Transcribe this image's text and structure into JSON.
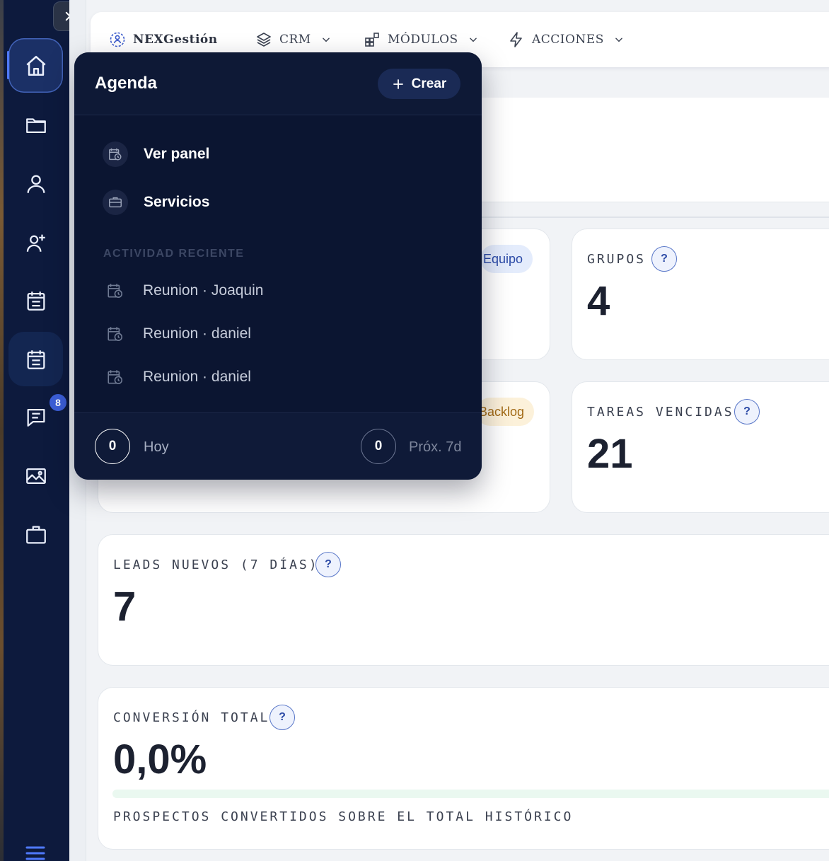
{
  "sidebar": {
    "toggle_icon": "chevron-right-icon",
    "items": [
      {
        "name": "home",
        "icon": "home-icon"
      },
      {
        "name": "folder",
        "icon": "folder-icon"
      },
      {
        "name": "user",
        "icon": "user-icon"
      },
      {
        "name": "add-user",
        "icon": "user-plus-icon"
      },
      {
        "name": "calendar",
        "icon": "calendar-icon"
      },
      {
        "name": "agenda",
        "icon": "calendar-icon"
      },
      {
        "name": "messages",
        "icon": "message-icon",
        "badge": "8"
      },
      {
        "name": "gallery",
        "icon": "image-icon"
      },
      {
        "name": "briefcase",
        "icon": "briefcase-icon"
      }
    ],
    "menu_icon": "hamburger-icon"
  },
  "topbar": {
    "brand": "NEXGestión",
    "menus": [
      {
        "label": "CRM",
        "icon": "layers-icon"
      },
      {
        "label": "MÓDULOS",
        "icon": "grid-plus-icon"
      },
      {
        "label": "ACCIONES",
        "icon": "bolt-icon"
      }
    ]
  },
  "cards": {
    "equipo_chip": "Equipo",
    "backlog_chip": "Backlog",
    "grupos": {
      "label": "GRUPOS",
      "value": "4"
    },
    "tareas_vencidas": {
      "label": "TAREAS VENCIDAS",
      "value": "21"
    },
    "leads_nuevos": {
      "label": "LEADS NUEVOS (7 DÍAS)",
      "value": "7"
    },
    "conversion": {
      "label": "CONVERSIÓN TOTAL",
      "value": "0,0%",
      "progress_fraction": 0.0,
      "caption": "PROSPECTOS CONVERTIDOS SOBRE EL TOTAL HISTÓRICO"
    },
    "help_glyph": "?"
  },
  "popover": {
    "title": "Agenda",
    "create_label": "Crear",
    "links": [
      {
        "label": "Ver panel",
        "icon": "calendar-clock-icon"
      },
      {
        "label": "Servicios",
        "icon": "briefcase-icon"
      }
    ],
    "section_label": "ACTIVIDAD RECIENTE",
    "recent": [
      {
        "label": "Reunion · Joaquin"
      },
      {
        "label": "Reunion · daniel"
      },
      {
        "label": "Reunion · daniel"
      }
    ],
    "footer": {
      "today_count": "0",
      "today_label": "Hoy",
      "next_count": "0",
      "next_label": "Próx. 7d"
    }
  },
  "colors": {
    "sidebar_bg": "#0d1a3d",
    "accent": "#4f79ff",
    "popover_bg": "#0b1531",
    "badge": "#3c5fd8"
  }
}
